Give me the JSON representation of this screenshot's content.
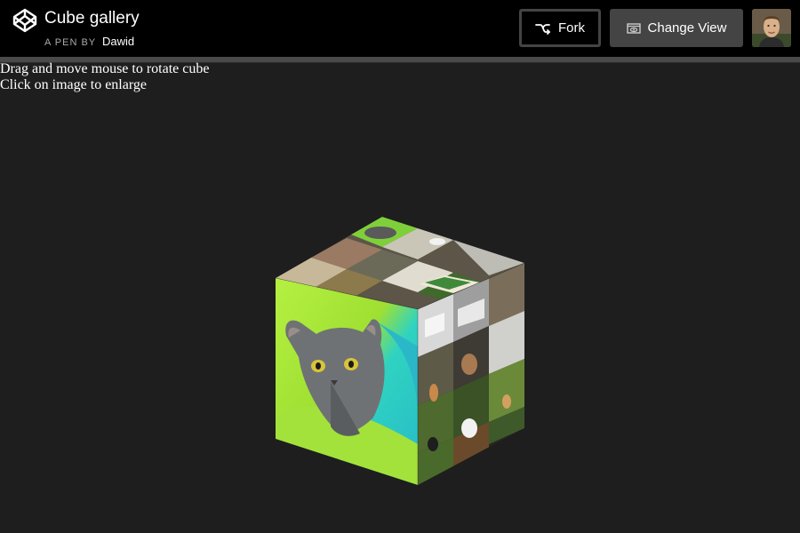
{
  "header": {
    "title": "Cube gallery",
    "byline_prefix": "A PEN BY",
    "author": "Dawid",
    "fork_label": "Fork",
    "change_view_label": "Change View"
  },
  "icons": {
    "logo": "codepen-logo-icon",
    "fork": "fork-icon",
    "change_view": "eye-icon"
  },
  "instructions": [
    "Drag and move mouse to rotate cube",
    "Click on image to enlarge"
  ],
  "colors": {
    "header_bg": "#000000",
    "page_bg": "#1e1e1e",
    "button_gray": "#444444"
  }
}
